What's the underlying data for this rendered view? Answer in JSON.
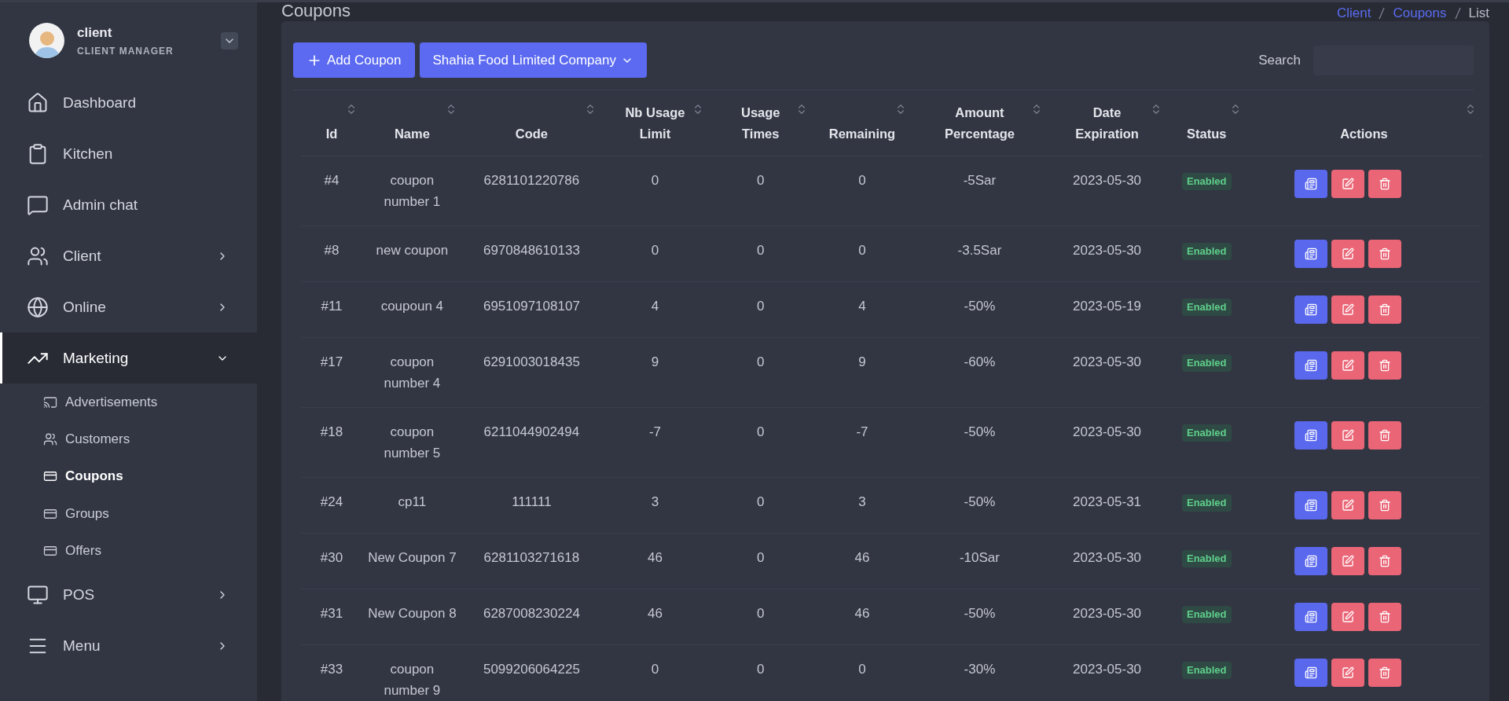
{
  "user": {
    "name": "client",
    "role": "CLIENT MANAGER"
  },
  "sidebar": {
    "items": [
      {
        "label": "Dashboard",
        "selected": false
      },
      {
        "label": "Kitchen",
        "selected": false
      },
      {
        "label": "Admin chat",
        "selected": false
      },
      {
        "label": "Client",
        "selected": false,
        "expanded": false
      },
      {
        "label": "Online",
        "selected": false,
        "expanded": false
      },
      {
        "label": "Marketing",
        "selected": true,
        "expanded": true,
        "children": [
          {
            "label": "Advertisements",
            "selected": false
          },
          {
            "label": "Customers",
            "selected": false
          },
          {
            "label": "Coupons",
            "selected": true
          },
          {
            "label": "Groups",
            "selected": false
          },
          {
            "label": "Offers",
            "selected": false
          }
        ]
      },
      {
        "label": "POS",
        "selected": false,
        "expanded": false
      },
      {
        "label": "Menu",
        "selected": false,
        "expanded": false
      }
    ]
  },
  "page_title": "Coupons",
  "breadcrumb": [
    {
      "label": "Client",
      "link": true
    },
    {
      "label": "Coupons",
      "link": true
    },
    {
      "label": "List",
      "link": false
    }
  ],
  "toolbar": {
    "add_button": "Add Coupon",
    "company_select": "Shahia Food Limited Company",
    "search_label": "Search"
  },
  "table": {
    "columns": [
      "Id",
      "Name",
      "Code",
      "Nb Usage Limit",
      "Usage Times",
      "Remaining",
      "Amount Percentage",
      "Date Expiration",
      "Status",
      "Actions"
    ],
    "rows": [
      {
        "id": "#4",
        "name": "coupon number 1",
        "code": "6281101220786",
        "limit": "0",
        "times": "0",
        "remaining": "0",
        "amount": "-5Sar",
        "date": "2023-05-30",
        "status": "Enabled"
      },
      {
        "id": "#8",
        "name": "new coupon",
        "code": "6970848610133",
        "limit": "0",
        "times": "0",
        "remaining": "0",
        "amount": "-3.5Sar",
        "date": "2023-05-30",
        "status": "Enabled"
      },
      {
        "id": "#11",
        "name": "coupoun 4",
        "code": "6951097108107",
        "limit": "4",
        "times": "0",
        "remaining": "4",
        "amount": "-50%",
        "date": "2023-05-19",
        "status": "Enabled"
      },
      {
        "id": "#17",
        "name": "coupon number 4",
        "code": "6291003018435",
        "limit": "9",
        "times": "0",
        "remaining": "9",
        "amount": "-60%",
        "date": "2023-05-30",
        "status": "Enabled"
      },
      {
        "id": "#18",
        "name": "coupon number 5",
        "code": "6211044902494",
        "limit": "-7",
        "times": "0",
        "remaining": "-7",
        "amount": "-50%",
        "date": "2023-05-30",
        "status": "Enabled"
      },
      {
        "id": "#24",
        "name": "cp11",
        "code": "111111",
        "limit": "3",
        "times": "0",
        "remaining": "3",
        "amount": "-50%",
        "date": "2023-05-31",
        "status": "Enabled"
      },
      {
        "id": "#30",
        "name": "New Coupon 7",
        "code": "6281103271618",
        "limit": "46",
        "times": "0",
        "remaining": "46",
        "amount": "-10Sar",
        "date": "2023-05-30",
        "status": "Enabled"
      },
      {
        "id": "#31",
        "name": "New Coupon 8",
        "code": "6287008230224",
        "limit": "46",
        "times": "0",
        "remaining": "46",
        "amount": "-50%",
        "date": "2023-05-30",
        "status": "Enabled"
      },
      {
        "id": "#33",
        "name": "coupon number 9",
        "code": "5099206064225",
        "limit": "0",
        "times": "0",
        "remaining": "0",
        "amount": "-30%",
        "date": "2023-05-30",
        "status": "Enabled"
      }
    ]
  }
}
